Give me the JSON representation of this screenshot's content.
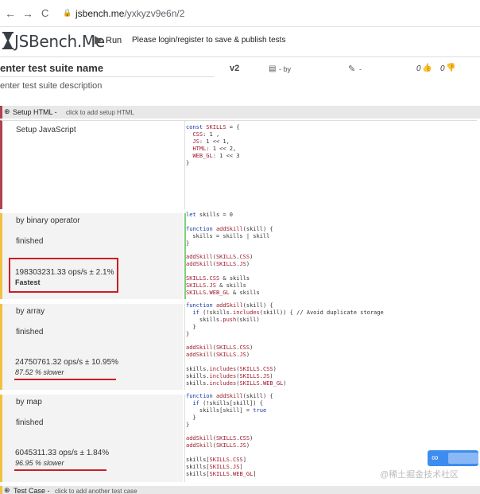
{
  "browser": {
    "back_glyph": "←",
    "forward_glyph": "→",
    "reload_glyph": "C",
    "lock_glyph": "🔒",
    "url_domain": "jsbench.me",
    "url_path": "/yxkyzv9e6n/2"
  },
  "header": {
    "logo": "JSBench.Me",
    "run_label": "Run",
    "notice": "Please login/register to save & publish tests"
  },
  "suite": {
    "name": "enter test suite name",
    "version": "v2",
    "by": "- by",
    "edit_suffix": "-",
    "likes": "0",
    "dislikes": "0",
    "description": "enter test suite description"
  },
  "setup_html": {
    "label": "Setup HTML -",
    "hint": "click to add setup HTML"
  },
  "setup_js": {
    "label": "Setup JavaScript",
    "code": [
      "const SKILLS = {",
      "  CSS: 1 ,",
      "  JS: 1 << 1,",
      "  HTML: 1 << 2,",
      "  WEB_GL: 1 << 3",
      "}"
    ]
  },
  "cases": [
    {
      "title": "by binary operator",
      "status": "finished",
      "ops": "198303231.33 ops/s ± 2.1%",
      "verdict": "Fastest",
      "code": [
        "let skills = 0",
        "",
        "function addSkill(skill) {",
        "  skills = skills | skill",
        "}",
        "",
        "addSkill(SKILLS.CSS)",
        "addSkill(SKILLS.JS)",
        "",
        "SKILLS.CSS & skills",
        "SKILLS.JS & skills",
        "SKILLS.WEB_GL & skills"
      ]
    },
    {
      "title": "by array",
      "status": "finished",
      "ops": "24750761.32 ops/s ± 10.95%",
      "verdict": "87.52 % slower",
      "code": [
        "function addSkill(skill) {",
        "  if (!skills.includes(skill)) { // Avoid duplicate storage",
        "    skills.push(skill)",
        "  }",
        "}",
        "",
        "addSkill(SKILLS.CSS)",
        "addSkill(SKILLS.JS)",
        "",
        "skills.includes(SKILLS.CSS)",
        "skills.includes(SKILLS.JS)",
        "skills.includes(SKILLS.WEB_GL)"
      ]
    },
    {
      "title": "by map",
      "status": "finished",
      "ops": "6045311.33 ops/s ± 1.84%",
      "verdict": "96.95 % slower",
      "code": [
        "function addSkill(skill) {",
        "  if (!skills[skill]) {",
        "    skills[skill] = true",
        "  }",
        "}",
        "",
        "addSkill(SKILLS.CSS)",
        "addSkill(SKILLS.JS)",
        "",
        "skills[SKILLS.CSS]",
        "skills[SKILLS.JS]",
        "skills[SKILLS.WEB_GL]"
      ]
    }
  ],
  "footer": {
    "label": "Test Case -",
    "hint": "click to add another test case"
  },
  "watermark": "@稀土掘金技术社区",
  "colors": {
    "accent": "#b04252",
    "case_bar": "#f0c040",
    "highlight": "#cc1d24",
    "brand_blue": "#3d8cf0"
  }
}
